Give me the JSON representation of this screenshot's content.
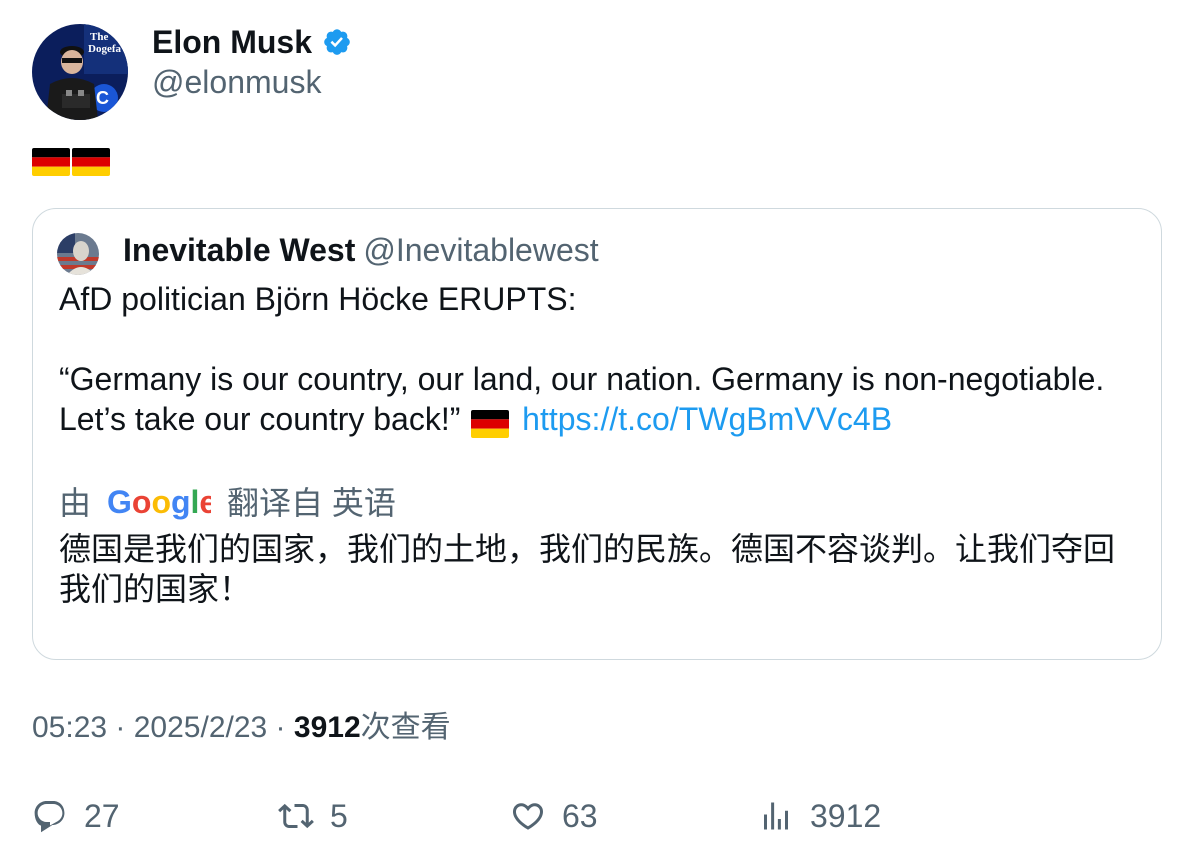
{
  "tweet": {
    "author": {
      "name": "Elon Musk",
      "handle": "@elonmusk"
    },
    "text_emoji": "germany-flag-emoji ×2",
    "quote": {
      "author": {
        "name": "Inevitable West",
        "handle": "@Inevitablewest"
      },
      "line1": "AfD politician Björn Höcke ERUPTS:",
      "line2": "“Germany is our country, our land, our nation. Germany is non-negotiable.",
      "line3": "Let’s take our country back!”",
      "link": "https://t.co/TWgBmVVc4B",
      "translated_prefix": "由",
      "translated_suffix": "翻译自 英语",
      "translation_line1": "德国是我们的国家，我们的土地，我们的民族。德国不容谈判。让我们夺回",
      "translation_line2": "我们的国家！"
    },
    "meta": {
      "time": "05:23",
      "date": "2025/2/23",
      "views": "3912",
      "views_label": "次查看"
    },
    "actions": {
      "replies": "27",
      "reposts": "5",
      "likes": "63",
      "views": "3912"
    }
  },
  "colors": {
    "accent": "#1d9bf0",
    "secondary_text": "#536471",
    "border": "#cfd9de"
  }
}
